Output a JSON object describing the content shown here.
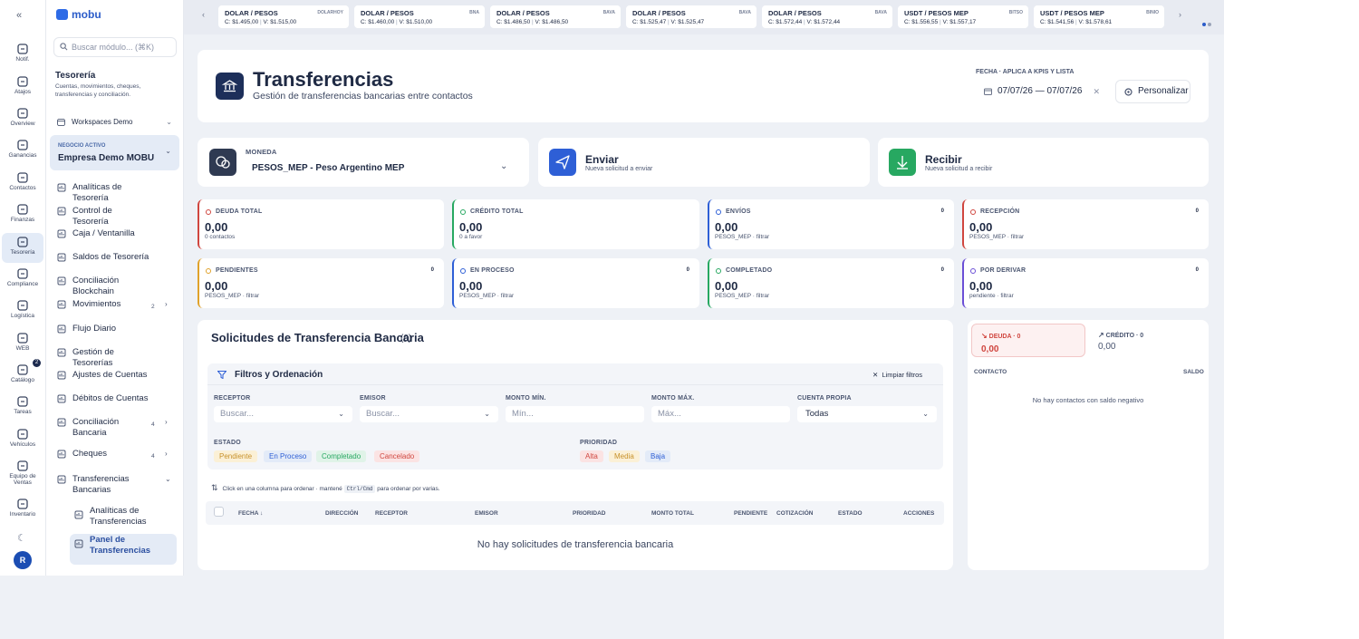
{
  "rail": {
    "items": [
      {
        "label": "Notif.",
        "icon": "bell-icon"
      },
      {
        "label": "Atajos",
        "icon": "shortcut-icon"
      },
      {
        "label": "Overview",
        "icon": "grid-icon"
      },
      {
        "label": "Ganancias",
        "icon": "trend-icon"
      },
      {
        "label": "Contactos",
        "icon": "users-icon"
      },
      {
        "label": "Finanzas",
        "icon": "chart-icon"
      },
      {
        "label": "Tesorería",
        "icon": "bank-icon",
        "active": true
      },
      {
        "label": "Compliance",
        "icon": "document-icon"
      },
      {
        "label": "Logística",
        "icon": "box-icon"
      },
      {
        "label": "WEB",
        "icon": "globe-icon"
      },
      {
        "label": "Catálogo",
        "icon": "catalog-icon",
        "badge": "2"
      },
      {
        "label": "Tareas",
        "icon": "clipboard-icon"
      },
      {
        "label": "Vehículos",
        "icon": "car-icon"
      },
      {
        "label": "Equipo de Ventas",
        "icon": "team-icon"
      },
      {
        "label": "Inventario",
        "icon": "cube-icon"
      }
    ],
    "avatar": "R"
  },
  "sidebar": {
    "brand": "mobu",
    "search_placeholder": "Buscar módulo... (⌘K)",
    "section_title": "Tesorería",
    "section_subtitle": "Cuentas, movimientos, cheques, transferencias y conciliación.",
    "workspace": "Workspaces Demo",
    "business_label": "NEGOCIO ACTIVO",
    "business_name": "Empresa Demo MOBU",
    "items": [
      {
        "label": "Analíticas de Tesorería"
      },
      {
        "label": "Control de Tesorería"
      },
      {
        "label": "Caja / Ventanilla"
      },
      {
        "label": "Saldos de Tesorería"
      },
      {
        "label": "Conciliación Blockchain"
      },
      {
        "label": "Movimientos",
        "count": "2"
      },
      {
        "label": "Flujo Diario"
      },
      {
        "label": "Gestión de Tesorerías"
      },
      {
        "label": "Ajustes de Cuentas"
      },
      {
        "label": "Débitos de Cuentas"
      },
      {
        "label": "Conciliación Bancaria",
        "count": "4"
      },
      {
        "label": "Cheques",
        "count": "4"
      },
      {
        "label": "Transferencias Bancarias"
      }
    ],
    "sub_items": [
      {
        "label": "Analíticas de Transferencias"
      },
      {
        "label": "Panel de Transferencias"
      }
    ]
  },
  "tickers": [
    {
      "pair": "DOLAR / PESOS",
      "buy": "C: $1.495,00",
      "sell": "V: $1.515,00",
      "source": "DOLARHOY"
    },
    {
      "pair": "DOLAR / PESOS",
      "buy": "C: $1.460,00",
      "sell": "V: $1.510,00",
      "source": "BNA"
    },
    {
      "pair": "DOLAR / PESOS",
      "buy": "C: $1.486,50",
      "sell": "V: $1.486,50",
      "source": "BAVA"
    },
    {
      "pair": "DOLAR / PESOS",
      "buy": "C: $1.525,47",
      "sell": "V: $1.525,47",
      "source": "BAVA"
    },
    {
      "pair": "DOLAR / PESOS",
      "buy": "C: $1.572,44",
      "sell": "V: $1.572,44",
      "source": "BAVA"
    },
    {
      "pair": "USDT / PESOS MEP",
      "buy": "C: $1.556,55",
      "sell": "V: $1.557,17",
      "source": "BITSO"
    },
    {
      "pair": "USDT / PESOS MEP",
      "buy": "C: $1.541,56",
      "sell": "V: $1.578,61",
      "source": "BINIO"
    }
  ],
  "header": {
    "title": "Transferencias",
    "subtitle": "Gestión de transferencias bancarias entre contactos",
    "date_label": "FECHA · APLICA A KPIS Y LISTA",
    "date_range": "07/07/26 — 07/07/26",
    "customize": "Personalizar"
  },
  "currency": {
    "label": "MONEDA",
    "value": "PESOS_MEP - Peso Argentino MEP"
  },
  "actions": [
    {
      "title": "Enviar",
      "subtitle": "Nueva solicitud a enviar",
      "color": "#2e5fd6"
    },
    {
      "title": "Recibir",
      "subtitle": "Nueva solicitud a recibir",
      "color": "#27a861"
    }
  ],
  "kpis": [
    {
      "label": "DEUDA TOTAL",
      "value": "0,00",
      "sub": "0 contactos",
      "badge": "",
      "color": "#d0463f"
    },
    {
      "label": "CRÉDITO TOTAL",
      "value": "0,00",
      "sub": "0 a favor",
      "badge": "",
      "color": "#27a861"
    },
    {
      "label": "ENVÍOS",
      "value": "0,00",
      "sub": "PESOS_MEP · filtrar",
      "badge": "0",
      "color": "#2e5fd6"
    },
    {
      "label": "RECEPCIÓN",
      "value": "0,00",
      "sub": "PESOS_MEP · filtrar",
      "badge": "0",
      "color": "#d0463f"
    },
    {
      "label": "PENDIENTES",
      "value": "0,00",
      "sub": "PESOS_MEP · filtrar",
      "badge": "0",
      "color": "#e0a22a"
    },
    {
      "label": "EN PROCESO",
      "value": "0,00",
      "sub": "PESOS_MEP · filtrar",
      "badge": "0",
      "color": "#2e5fd6"
    },
    {
      "label": "COMPLETADO",
      "value": "0,00",
      "sub": "PESOS_MEP · filtrar",
      "badge": "0",
      "color": "#27a861"
    },
    {
      "label": "POR DERIVAR",
      "value": "0,00",
      "sub": "pendiente · filtrar",
      "badge": "0",
      "color": "#6b4fd6"
    }
  ],
  "solicitudes": {
    "title": "Solicitudes de Transferencia Bancaria",
    "count": "(0)",
    "filters_title": "Filtros y Ordenación",
    "clear": "Limpiar filtros",
    "receptor_label": "RECEPTOR",
    "receptor_placeholder": "Buscar...",
    "emisor_label": "EMISOR",
    "emisor_placeholder": "Buscar...",
    "min_label": "MONTO MÍN.",
    "min_placeholder": "Mín...",
    "max_label": "MONTO MÁX.",
    "max_placeholder": "Máx...",
    "cuenta_label": "CUENTA PROPIA",
    "cuenta_value": "Todas",
    "estado_label": "ESTADO",
    "estados": [
      "Pendiente",
      "En Proceso",
      "Completado",
      "Cancelado"
    ],
    "prioridad_label": "PRIORIDAD",
    "prioridades": [
      "Alta",
      "Media",
      "Baja"
    ],
    "hint_pre": "Click en una columna para ordenar · mantené",
    "hint_key": "Ctrl/Cmd",
    "hint_post": "para ordenar por varias.",
    "columns": [
      "FECHA ↓",
      "DIRECCIÓN",
      "RECEPTOR",
      "EMISOR",
      "PRIORIDAD",
      "MONTO TOTAL",
      "PENDIENTE",
      "COTIZACIÓN",
      "ESTADO",
      "ACCIONES"
    ],
    "empty": "No hay solicitudes de transferencia bancaria"
  },
  "balance": {
    "deuda_label": "DEUDA · 0",
    "deuda_value": "0,00",
    "credito_label": "CRÉDITO · 0",
    "credito_value": "0,00",
    "col_contact": "CONTACTO",
    "col_balance": "SALDO",
    "empty": "No hay contactos con saldo negativo"
  }
}
